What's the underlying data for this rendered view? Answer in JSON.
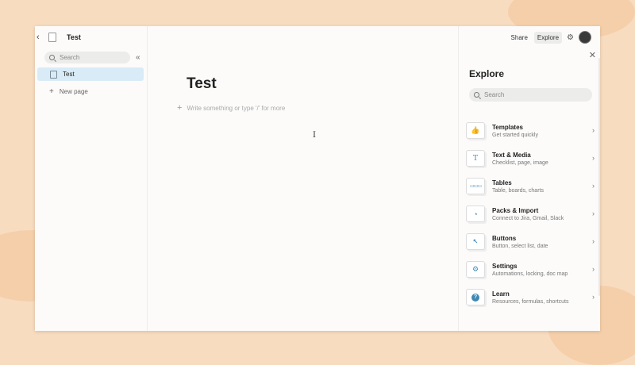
{
  "sidebar": {
    "doc_title": "Test",
    "search_placeholder": "Search",
    "items": [
      {
        "label": "Test"
      }
    ],
    "new_page_label": "New page"
  },
  "main": {
    "title": "Test",
    "prompt": "Write something or type '/' for more"
  },
  "topbar": {
    "share_label": "Share",
    "explore_label": "Explore"
  },
  "explore": {
    "title": "Explore",
    "search_placeholder": "Search",
    "items": [
      {
        "title": "Templates",
        "subtitle": "Get started quickly",
        "icon": "thumbs-up-icon"
      },
      {
        "title": "Text & Media",
        "subtitle": "Checklist, page, image",
        "icon": "text-icon"
      },
      {
        "title": "Tables",
        "subtitle": "Table, boards, charts",
        "icon": "table-icon"
      },
      {
        "title": "Packs & Import",
        "subtitle": "Connect to Jira, Gmail, Slack",
        "icon": "pack-icon"
      },
      {
        "title": "Buttons",
        "subtitle": "Button, select list, date",
        "icon": "button-icon"
      },
      {
        "title": "Settings",
        "subtitle": "Automations, locking, doc map",
        "icon": "gear-icon"
      },
      {
        "title": "Learn",
        "subtitle": "Resources, formulas, shortcuts",
        "icon": "question-icon"
      }
    ]
  },
  "colors": {
    "background": "#f8dcc0",
    "accent": "#3f88b3",
    "selected": "#d9ebf6"
  }
}
